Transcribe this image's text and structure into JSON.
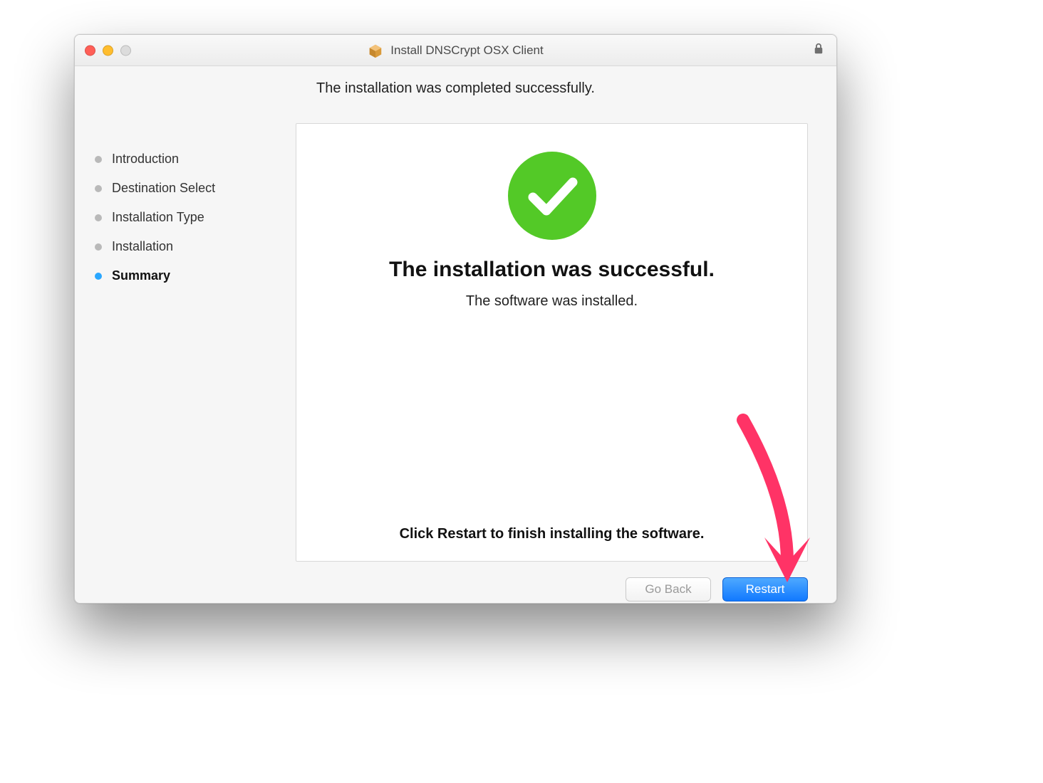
{
  "window": {
    "title": "Install DNSCrypt OSX Client"
  },
  "subtitle": "The installation was completed successfully.",
  "sidebar": {
    "steps": [
      {
        "label": "Introduction",
        "active": false
      },
      {
        "label": "Destination Select",
        "active": false
      },
      {
        "label": "Installation Type",
        "active": false
      },
      {
        "label": "Installation",
        "active": false
      },
      {
        "label": "Summary",
        "active": true
      }
    ]
  },
  "panel": {
    "headline": "The installation was successful.",
    "sub": "The software was installed.",
    "footer": "Click Restart to finish installing the software."
  },
  "buttons": {
    "back": "Go Back",
    "primary": "Restart"
  }
}
